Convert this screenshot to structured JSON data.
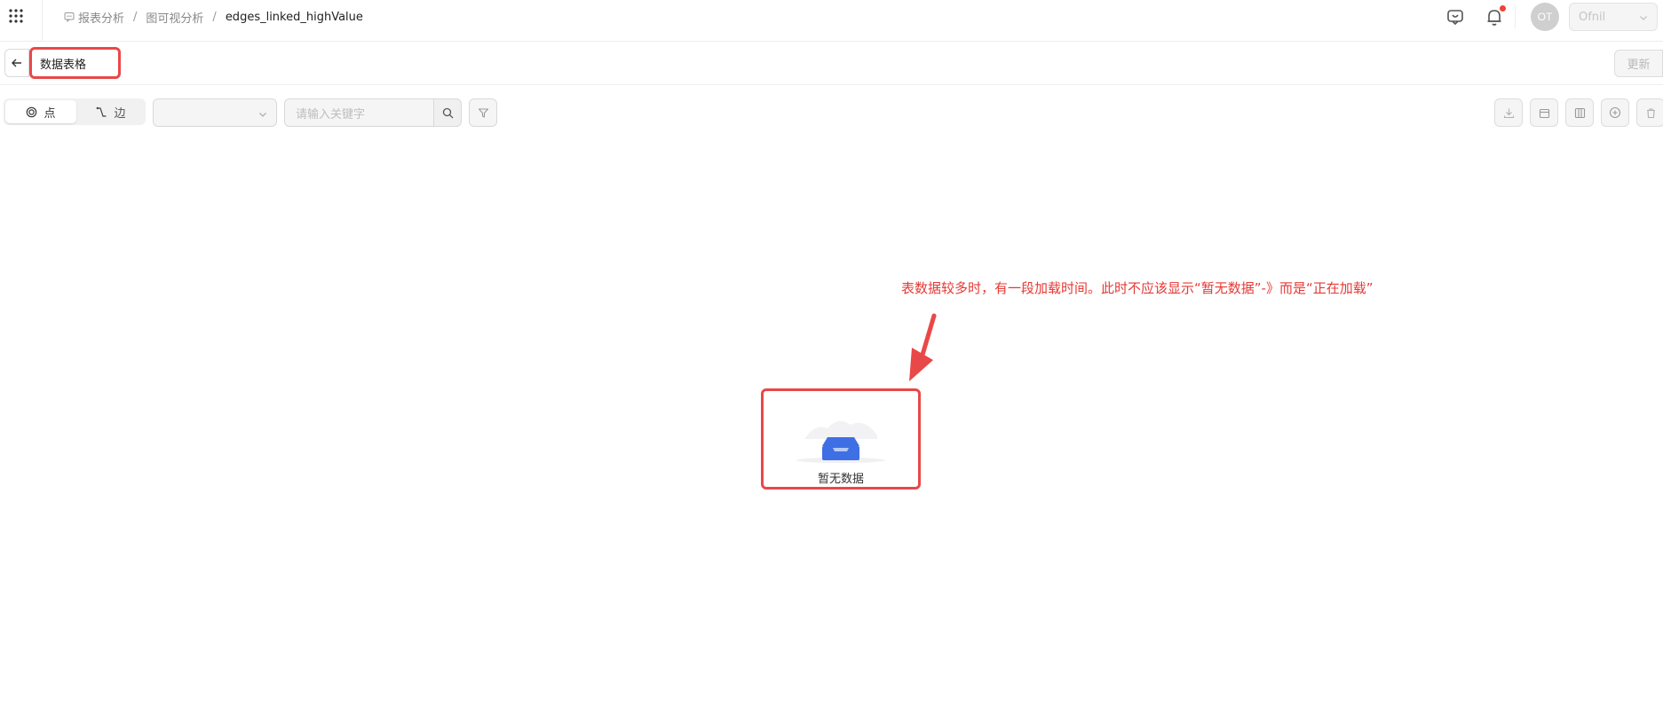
{
  "topbar": {
    "breadcrumb": [
      {
        "label": "报表分析",
        "icon": "report-icon"
      },
      {
        "label": "图可视分析"
      }
    ],
    "breadcrumb_separator": "/",
    "current_page": "edges_linked_highValue",
    "avatar_initials": "OT",
    "workspace_select_value": "Ofnil",
    "has_notification": true
  },
  "title_bar": {
    "title_value": "数据表格",
    "update_label": "更新"
  },
  "toolbar": {
    "tabs": [
      {
        "label": "点",
        "icon": "node-icon",
        "active": true
      },
      {
        "label": "边",
        "icon": "edge-icon",
        "active": false
      }
    ],
    "filter_select_value": "",
    "search_placeholder": "请输入关键字",
    "actions": [
      "download-icon",
      "calendar-icon",
      "columns-icon",
      "add-circle-icon",
      "trash-icon"
    ]
  },
  "annotation": {
    "text": "表数据较多时，有一段加载时间。此时不应该显示“暂无数据”-》而是“正在加载”",
    "color": "#e53935"
  },
  "empty_state": {
    "text": "暂无数据",
    "illustration": "empty-box-icon"
  },
  "colors": {
    "highlight_red": "#e94848",
    "accent_blue": "#3f6fe5",
    "notification_dot": "#f04134"
  }
}
